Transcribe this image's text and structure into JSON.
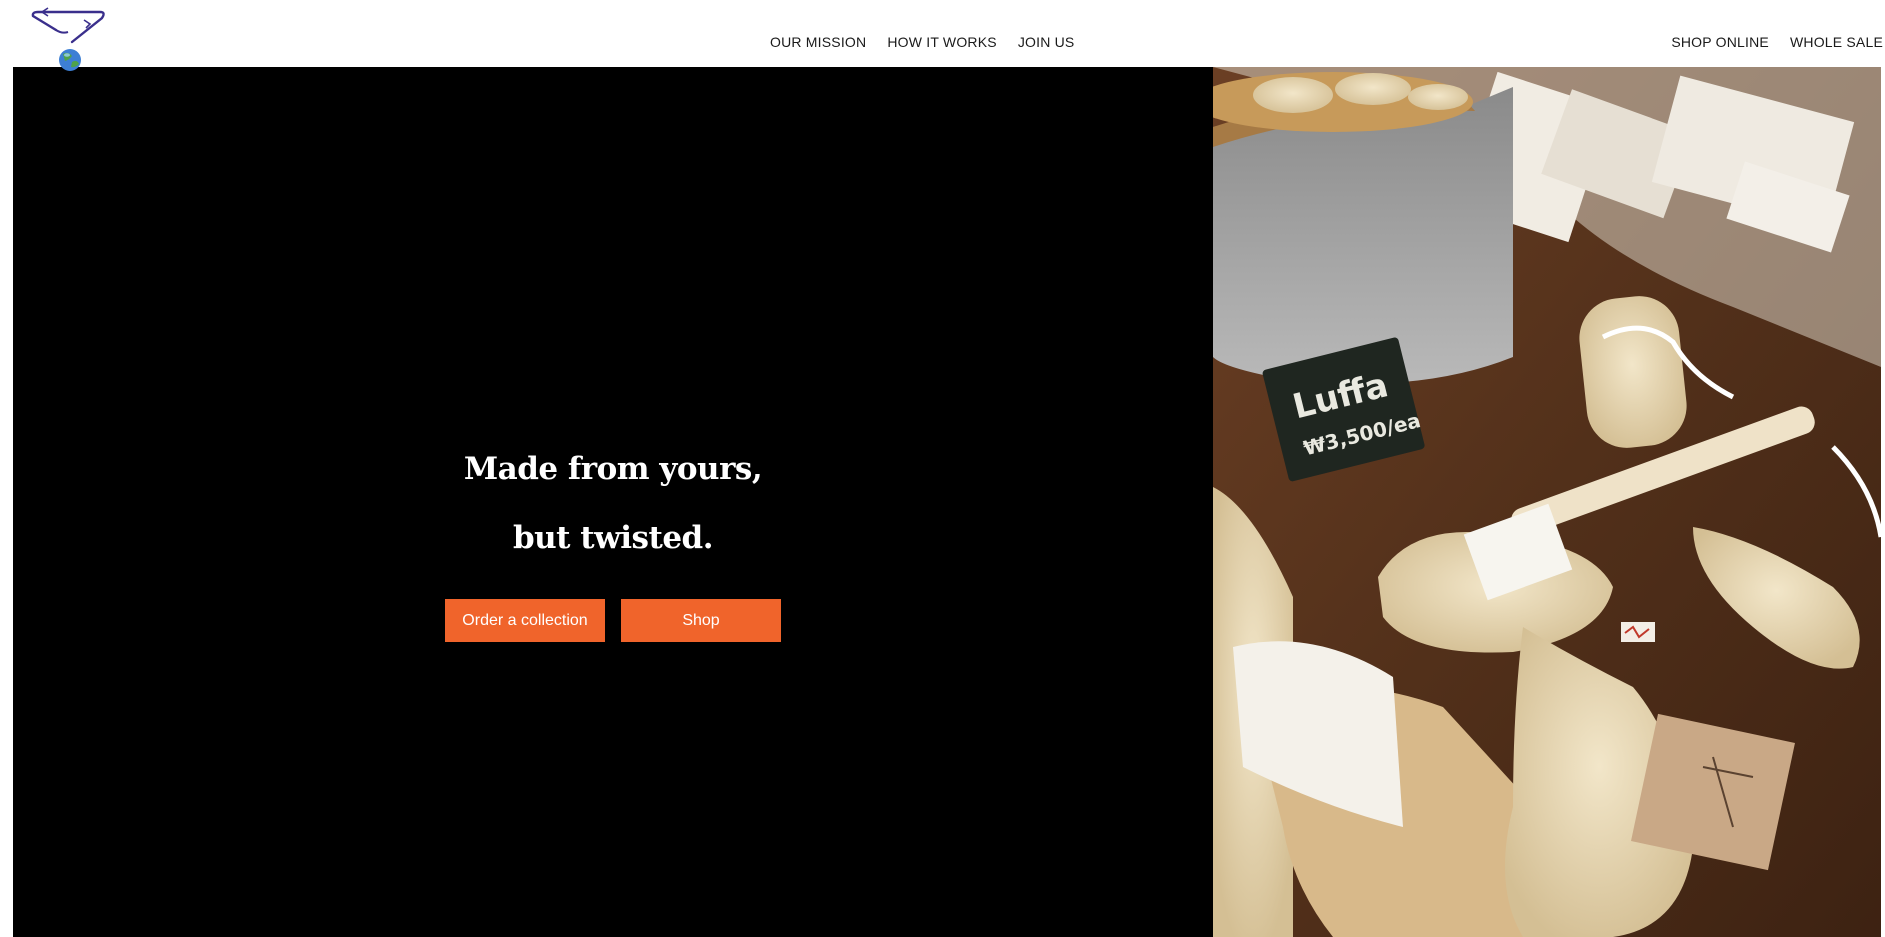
{
  "header": {
    "logo_icon": "hanger-globe-logo",
    "nav_center": [
      "OUR MISSION",
      "HOW IT WORKS",
      "JOIN US"
    ],
    "nav_right": [
      "SHOP ONLINE",
      "WHOLE SALE"
    ]
  },
  "hero": {
    "headline_line1": "Made from yours,",
    "headline_line2": "but twisted.",
    "order_button": "Order a collection",
    "shop_button": "Shop",
    "background": "#000000",
    "accent": "#f0642b"
  },
  "photo": {
    "icon": "luffa-products-photo",
    "sign_line1": "Luffa",
    "sign_line2": "₩3,500/ea"
  }
}
